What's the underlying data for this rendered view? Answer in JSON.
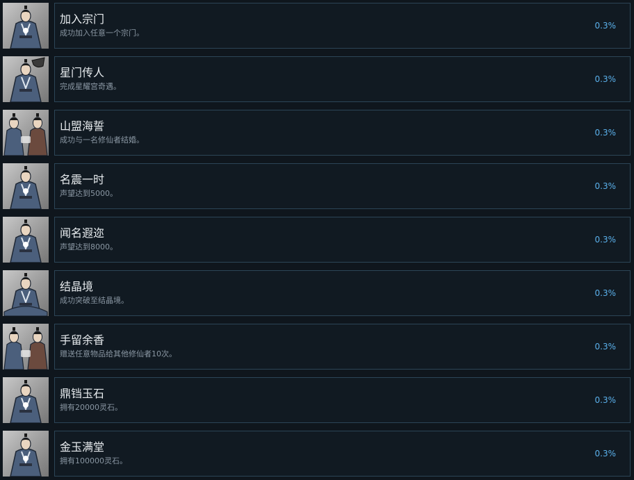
{
  "achievements": [
    {
      "title": "加入宗门",
      "description": "成功加入任意一个宗门。",
      "percent": "0.3%",
      "icon": "cultivator-glow-icon"
    },
    {
      "title": "星门传人",
      "description": "完成星耀宫奇遇。",
      "percent": "0.3%",
      "icon": "cultivator-hat-icon"
    },
    {
      "title": "山盟海誓",
      "description": "成功与一名修仙者结婚。",
      "percent": "0.3%",
      "icon": "couple-icon"
    },
    {
      "title": "名震一时",
      "description": "声望达到5000。",
      "percent": "0.3%",
      "icon": "cultivator-glow-icon"
    },
    {
      "title": "闻名遐迩",
      "description": "声望达到8000。",
      "percent": "0.3%",
      "icon": "cultivator-glow-icon"
    },
    {
      "title": "结晶境",
      "description": "成功突破至结晶境。",
      "percent": "0.3%",
      "icon": "cultivator-meditate-icon"
    },
    {
      "title": "手留余香",
      "description": "赠送任意物品给其他修仙者10次。",
      "percent": "0.3%",
      "icon": "couple-icon"
    },
    {
      "title": "鼎铛玉石",
      "description": "拥有20000灵石。",
      "percent": "0.3%",
      "icon": "cultivator-glow-icon"
    },
    {
      "title": "金玉满堂",
      "description": "拥有100000灵石。",
      "percent": "0.3%",
      "icon": "cultivator-glow-icon"
    }
  ],
  "colors": {
    "background": "#0f161d",
    "card_border": "#2c4557",
    "title": "#e8ecef",
    "description": "#8a97a3",
    "percent": "#5bb1ec",
    "robe": "#4b5f7c",
    "robe_brown": "#6b4a3e"
  }
}
